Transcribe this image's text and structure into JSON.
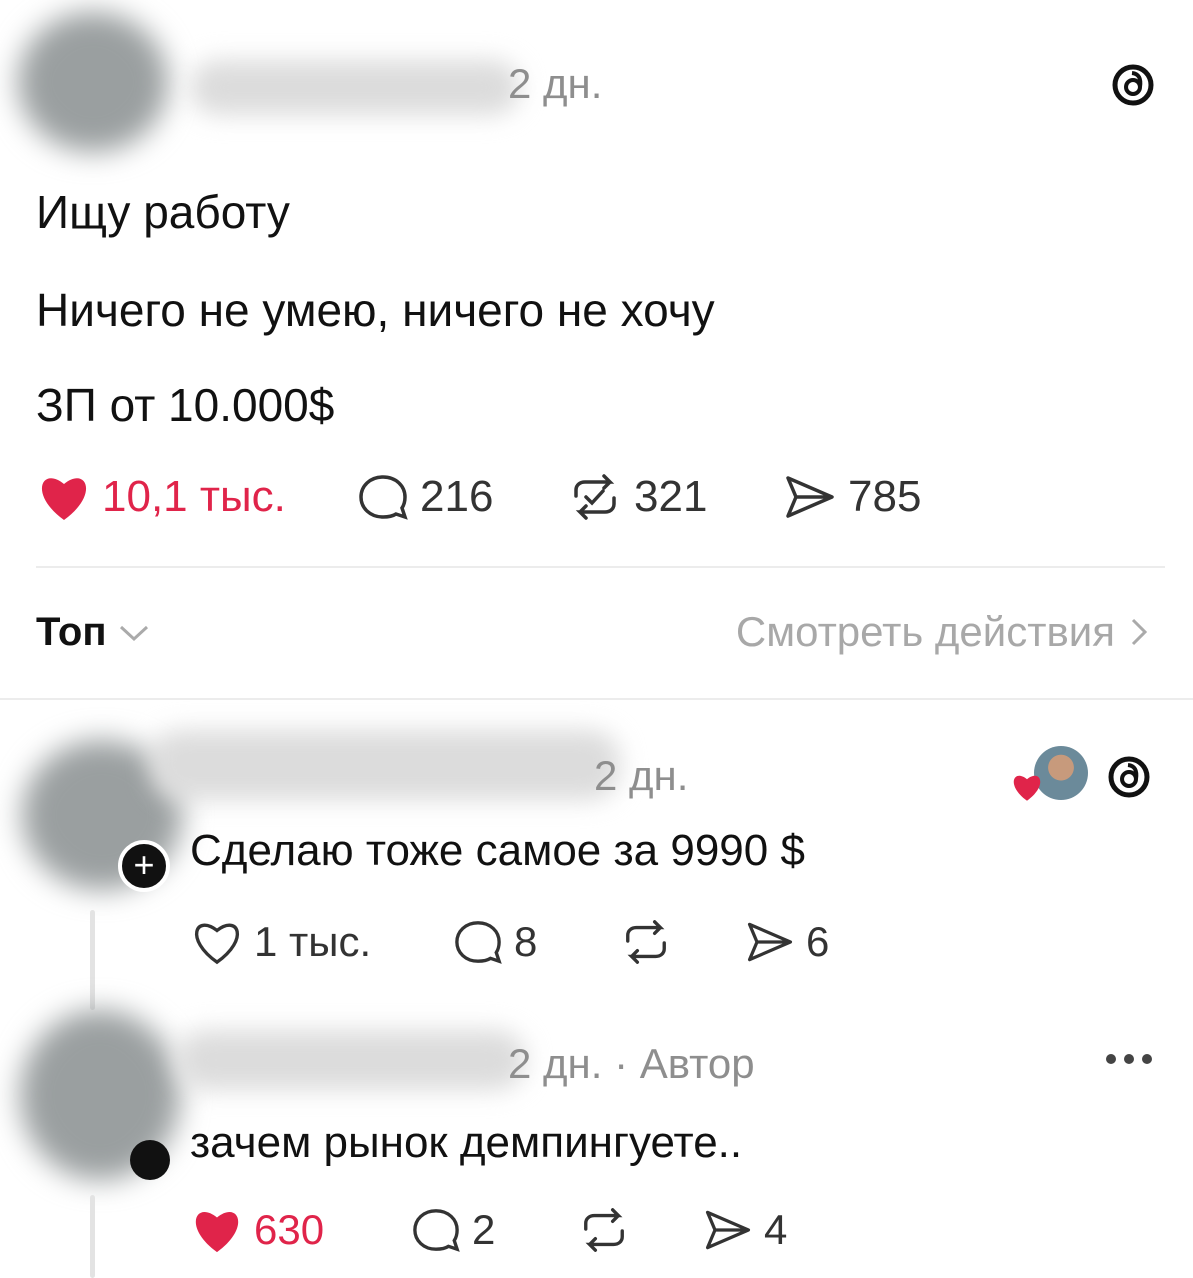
{
  "post": {
    "time": "2 дн.",
    "lines": [
      "Ищу работу",
      "Ничего не умею, ничего не хочу",
      "ЗП от 10.000$"
    ],
    "likes": "10,1 тыс.",
    "comments": "216",
    "reposts": "321",
    "shares": "785"
  },
  "replies_bar": {
    "sort_label": "Топ",
    "activity_link": "Смотреть действия"
  },
  "replies": [
    {
      "time": "2 дн.",
      "text": "Сделаю тоже самое за 9990 $",
      "likes": "1 тыс.",
      "comments": "8",
      "shares": "6",
      "liked_by_author": true
    },
    {
      "time": "2 дн.",
      "author_tag": "· Автор",
      "text": "зачем рынок демпингуете..",
      "likes": "630",
      "comments": "2",
      "shares": "4",
      "liked": true
    }
  ],
  "colors": {
    "like_red": "#e0244a",
    "muted_text": "#8e8e8e",
    "divider": "#ececec"
  },
  "icons": [
    "threads-logo-icon",
    "heart-icon",
    "comment-icon",
    "repost-icon",
    "share-icon",
    "chevron-down-icon",
    "chevron-right-icon",
    "more-icon",
    "follow-plus-icon"
  ]
}
